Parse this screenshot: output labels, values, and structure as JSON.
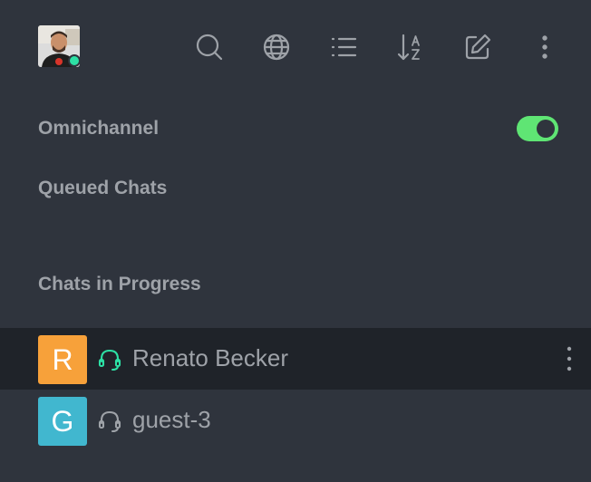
{
  "header": {
    "user_status_color": "#2de0a5",
    "toolbar": [
      {
        "name": "search-icon"
      },
      {
        "name": "directory-globe-icon"
      },
      {
        "name": "view-list-icon"
      },
      {
        "name": "sort-az-icon"
      },
      {
        "name": "create-new-icon"
      },
      {
        "name": "more-vertical-icon"
      }
    ]
  },
  "omnichannel": {
    "title": "Omnichannel",
    "toggle_on": true,
    "toggle_color": "#5fe574"
  },
  "sections": {
    "queued": "Queued Chats",
    "in_progress": "Chats in Progress"
  },
  "rooms": [
    {
      "initial": "R",
      "name": "Renato Becker",
      "avatar_color": "#f7a13a",
      "icon": "headset-icon",
      "icon_color": "#2de0a5",
      "active": true
    },
    {
      "initial": "G",
      "name": "guest-3",
      "avatar_color": "#41b7cf",
      "icon": "headset-icon",
      "icon_color": "#9ea2a8",
      "active": false
    }
  ]
}
